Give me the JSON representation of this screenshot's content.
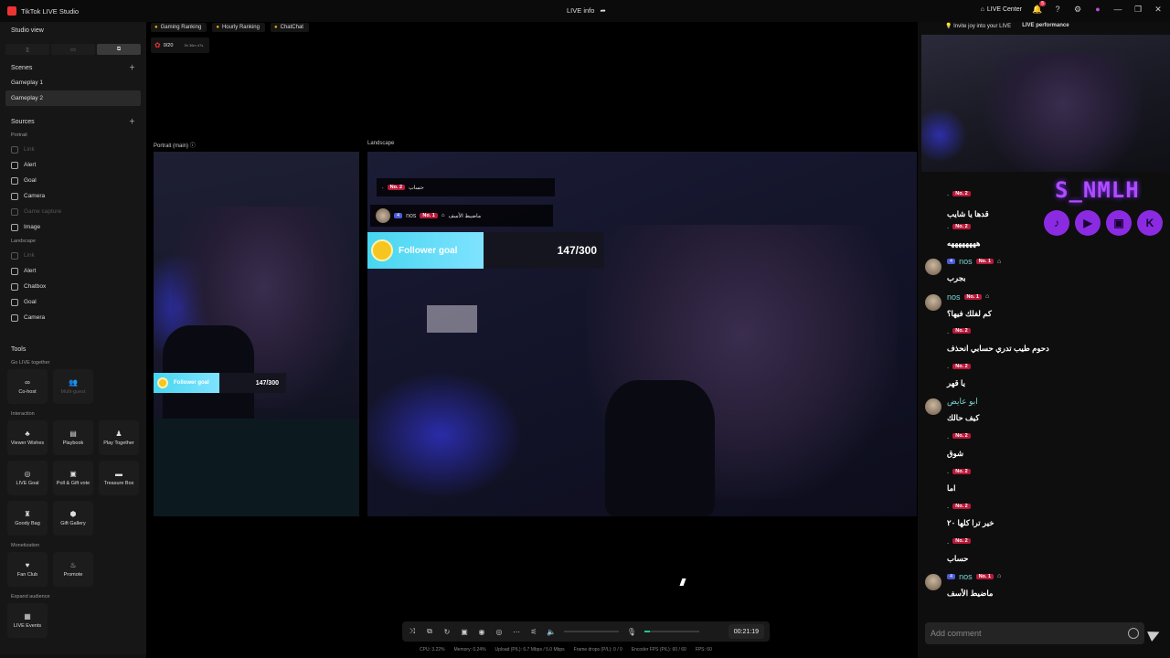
{
  "app": {
    "title": "TikTok LIVE Studio",
    "center_title": "LIVE info",
    "center_icon": "share-icon"
  },
  "titlebar": {
    "live_center": "LIVE Center",
    "notif_count": "5"
  },
  "sidebar": {
    "studio_view": "Studio view",
    "scenes_label": "Scenes",
    "scenes": [
      "Gameplay 1",
      "Gameplay 2"
    ],
    "selected_scene": "Gameplay 2",
    "sources_label": "Sources",
    "portrait_label": "Portrait",
    "portrait_sources": [
      "Link",
      "Alert",
      "Goal",
      "Camera",
      "Game capture",
      "Image"
    ],
    "landscape_label": "Landscape",
    "landscape_sources": [
      "Link",
      "Alert",
      "Chatbox",
      "Goal",
      "Camera"
    ],
    "tools_label": "Tools",
    "go_live_together": "Go LIVE together",
    "cohost": "Co-host",
    "multi_guest": "Multi-guest",
    "interaction": "Interaction",
    "interaction_tools": [
      "Viewer Wishes",
      "Playbook",
      "Play Together",
      "LIVE Goal",
      "Poll & Gift vote",
      "Treasure Box",
      "Goody Bag",
      "Gift Gallery"
    ],
    "monetization": "Monetization",
    "monetization_tools": [
      "Fan Club",
      "Promote"
    ],
    "expand_audience": "Expand audience",
    "live_events": "LIVE Events"
  },
  "rankings": [
    "Gaming Ranking",
    "Hourly Ranking",
    "ChatChat"
  ],
  "mini_card": {
    "count": "0/20",
    "time": "3h 36m 47s"
  },
  "stages": {
    "portrait_label": "Portrait (main)",
    "landscape_label": "Landscape"
  },
  "follower_goal": {
    "label": "Follower goal",
    "count": "147/300"
  },
  "overlay_msgs": [
    {
      "user": ".",
      "rank": "No. 2",
      "text": "حساب"
    },
    {
      "level": "4",
      "user": "nos",
      "rank": "No. 1",
      "text": "ماضيط الأسف"
    }
  ],
  "right_panel": {
    "invite": "Invite joy into your LIVE",
    "performance": "LIVE performance",
    "brand": "S_NMLH",
    "comment_placeholder": "Add comment"
  },
  "chat": [
    {
      "user": ".",
      "rank": "No. 2",
      "text": "قدها يا شايب",
      "avatar": false
    },
    {
      "user": ".",
      "rank": "No. 2",
      "text": "ههههههههه",
      "avatar": false
    },
    {
      "user": "nos",
      "level": "4",
      "rank": "No. 1",
      "text": "بجرب",
      "avatar": true
    },
    {
      "user": "nos",
      "rank": "No. 1",
      "text": "كم لفلك فيها؟",
      "avatar": true
    },
    {
      "user": ".",
      "rank": "No. 2",
      "text": "دحوم طيب تدري حسابي انحذف",
      "avatar": false
    },
    {
      "user": ".",
      "rank": "No. 2",
      "text": "يا قهر",
      "avatar": false
    },
    {
      "user": "ابو عايض",
      "text": "كيف حالك",
      "avatar": true
    },
    {
      "user": ".",
      "rank": "No. 2",
      "text": "شوق",
      "avatar": false
    },
    {
      "user": ".",
      "rank": "No. 2",
      "text": "اما",
      "avatar": false
    },
    {
      "user": ".",
      "rank": "No. 2",
      "text": "خير ترا كلها ٢٠",
      "avatar": false
    },
    {
      "user": ".",
      "rank": "No. 2",
      "text": "حساب",
      "avatar": false
    },
    {
      "user": "nos",
      "level": "4",
      "rank": "No. 1",
      "text": "ماضيط الأسف",
      "avatar": true
    }
  ],
  "controls": {
    "timer": "00:21:19",
    "mic_level": 0.1
  },
  "stats": {
    "cpu": "CPU: 3.22%",
    "memory": "Memory: 0.24%",
    "upload": "Upload (P/L): 6.7 Mbps / 5.0 Mbps",
    "frame_drops": "Frame drops (P/L): 0 / 0",
    "encoder_fps": "Encoder FPS (P/L): 60 / 60",
    "fps": "FPS: 60"
  }
}
